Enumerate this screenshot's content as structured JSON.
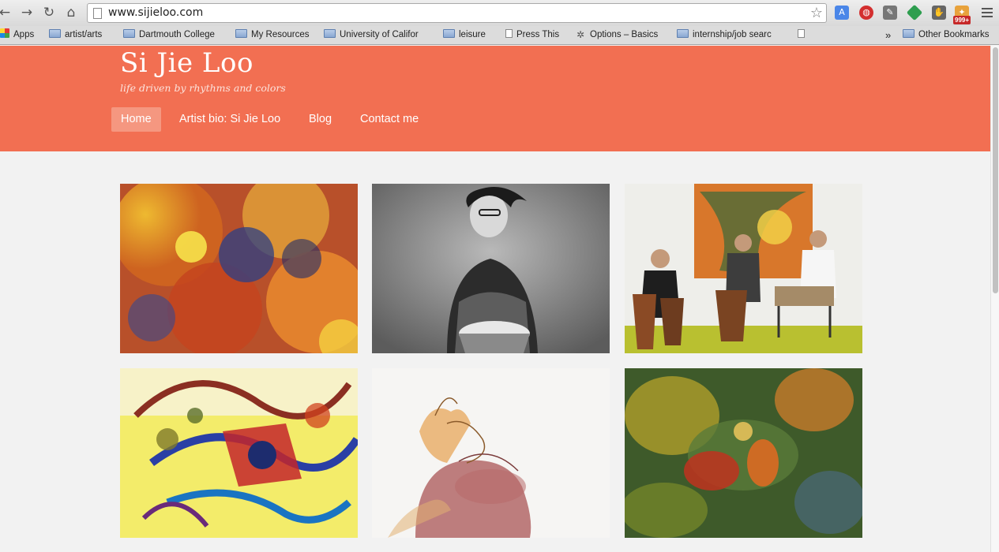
{
  "browser": {
    "url": "www.sijieloo.com",
    "extension_badge": "999+",
    "bookmarks": [
      {
        "label": "Apps",
        "icon": "apps-grid-icon"
      },
      {
        "label": "artist/arts",
        "icon": "folder-icon"
      },
      {
        "label": "Dartmouth College",
        "icon": "folder-icon"
      },
      {
        "label": "My Resources",
        "icon": "folder-icon"
      },
      {
        "label": "University of Califor",
        "icon": "folder-icon"
      },
      {
        "label": "leisure",
        "icon": "folder-icon"
      },
      {
        "label": "Press This",
        "icon": "page-icon"
      },
      {
        "label": "Options – Basics",
        "icon": "gear-icon"
      },
      {
        "label": "internship/job searc",
        "icon": "folder-icon"
      },
      {
        "label": "",
        "icon": "page-icon"
      }
    ],
    "overflow_label": "»",
    "other_bookmarks": "Other Bookmarks"
  },
  "site": {
    "title": "Si Jie Loo",
    "tagline": "life driven by rhythms and colors",
    "nav": [
      {
        "label": "Home",
        "active": true
      },
      {
        "label": "Artist bio: Si Jie Loo",
        "active": false
      },
      {
        "label": "Blog",
        "active": false
      },
      {
        "label": "Contact me",
        "active": false
      }
    ],
    "accent_color": "#f26f52",
    "active_nav_color": "#f59780"
  },
  "gallery": [
    {
      "subject": "abstract painting in orange, yellow and blue swirls"
    },
    {
      "subject": "black and white photo of woman playing djembe"
    },
    {
      "subject": "three musicians playing drums in front of painting"
    },
    {
      "subject": "colorful abstract painting with blue and red forms"
    },
    {
      "subject": "sketch of hands on a drum"
    },
    {
      "subject": "dark abstract painting in green, orange and red"
    }
  ]
}
